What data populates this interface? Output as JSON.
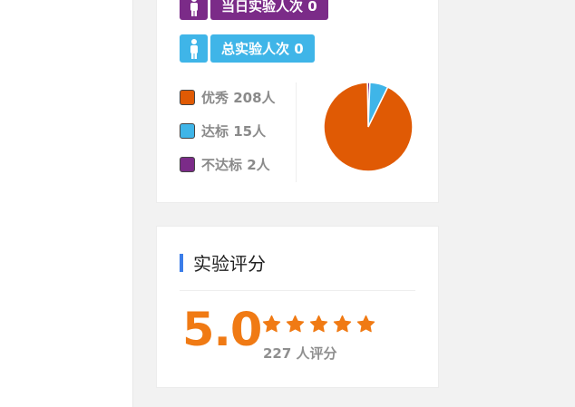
{
  "stats": {
    "today_label": "当日实验人次 0",
    "total_label": "总实验人次 0",
    "legend": [
      {
        "label": "优秀 208人",
        "color": "#e05a04",
        "value": 208
      },
      {
        "label": "达标 15人",
        "color": "#3fb5e8",
        "value": 15
      },
      {
        "label": "不达标 2人",
        "color": "#7b2b88",
        "value": 2
      }
    ]
  },
  "rating": {
    "title": "实验评分",
    "score": "5.0",
    "stars": 5,
    "count_label": "227 人评分",
    "accent": "#f07a14",
    "title_bar_color": "#3b7de9"
  }
}
